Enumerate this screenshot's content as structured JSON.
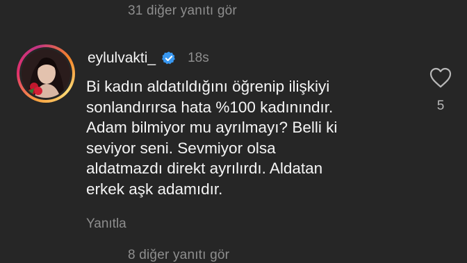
{
  "thread": {
    "more_replies_top": "31 diğer yanıtı gör",
    "more_replies_bottom": "8 diğer yanıtı gör"
  },
  "comment": {
    "username": "eylulvakti_",
    "verified_icon": "verified-badge-icon",
    "time_ago": "18s",
    "text": "Bi kadın aldatıldığını öğrenip ilişkiyi\nsonlandırırsa hata %100 kadınındır.\nAdam bilmiyor mu ayrılmayı? Belli ki\nseviyor seni. Sevmiyor olsa\naldatmazdı direkt ayrılırdı. Aldatan\nerkek aşk adamıdır.",
    "reply_label": "Yanıtla",
    "like_icon": "heart-outline-icon",
    "like_count": "5"
  },
  "colors": {
    "background": "#262626",
    "text_primary": "#f5f5f5",
    "text_secondary": "#8e8e8e",
    "verified": "#3897f0"
  }
}
